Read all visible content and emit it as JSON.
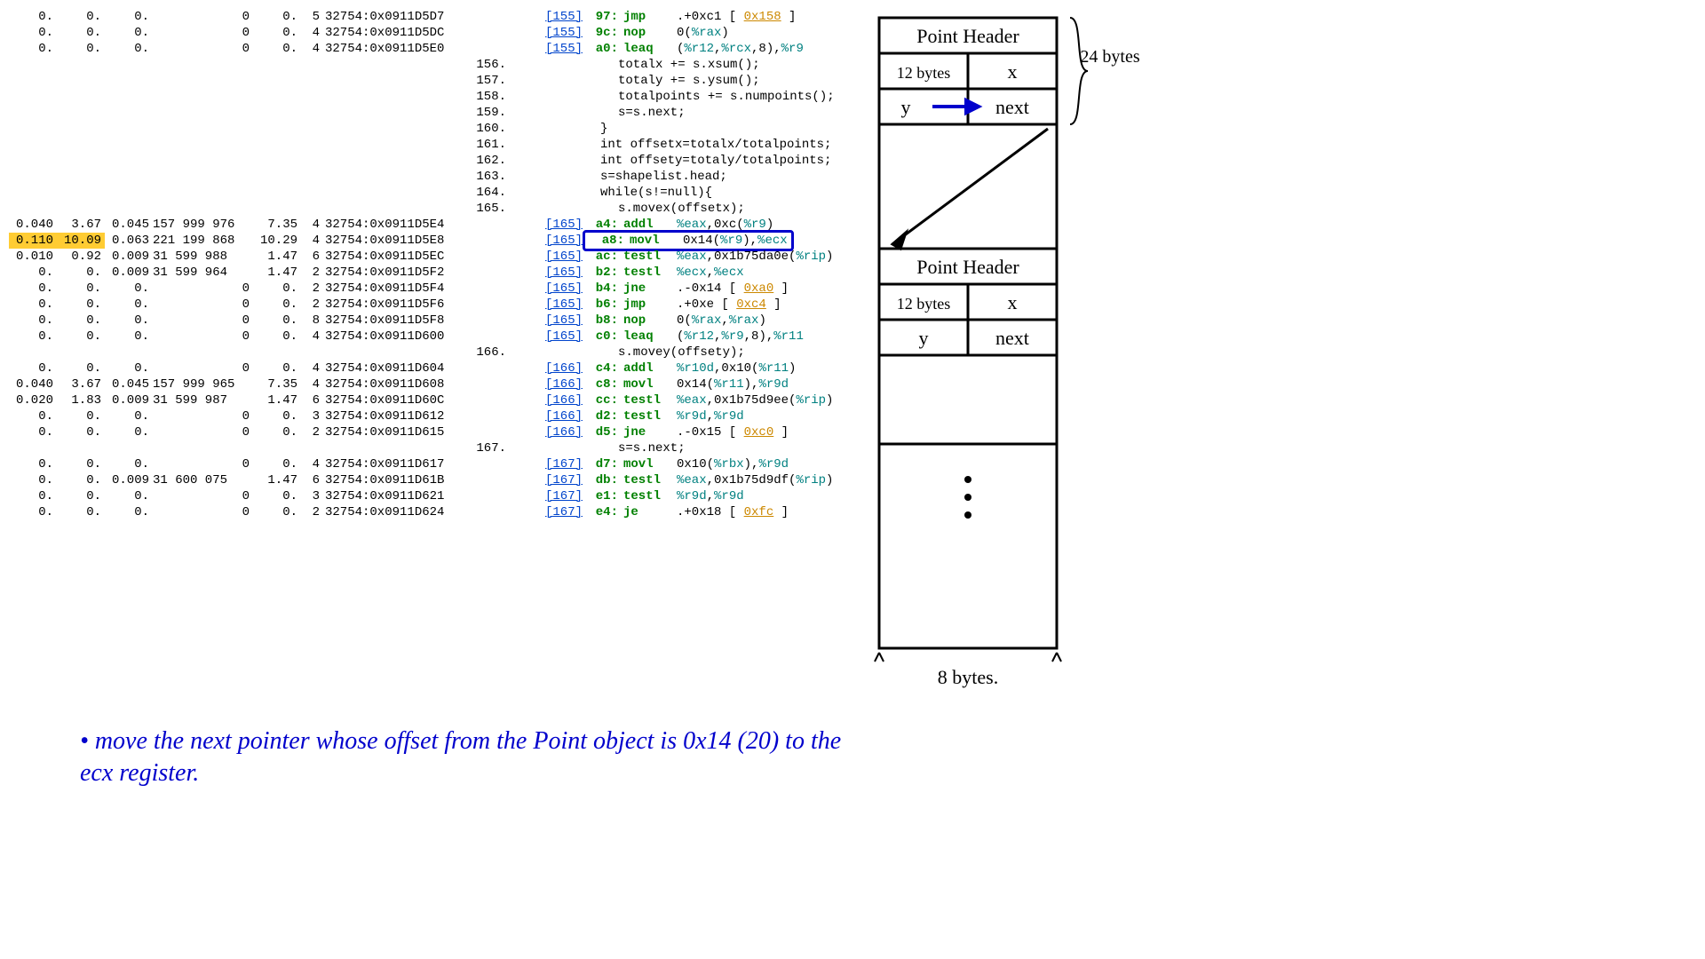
{
  "rows": [
    {
      "m": [
        "0.",
        "0.",
        "0.",
        "",
        "0",
        "0.",
        "5",
        "32754:0x0911D5D7"
      ],
      "lk": "155",
      "off": "97:",
      "mn": "jmp",
      "op": [
        {
          "t": ".+0xc1 [ "
        },
        {
          "t": "0x158",
          "c": "blk"
        },
        {
          "t": " ]"
        }
      ]
    },
    {
      "m": [
        "0.",
        "0.",
        "0.",
        "",
        "0",
        "0.",
        "4",
        "32754:0x0911D5DC"
      ],
      "lk": "155",
      "off": "9c:",
      "mn": "nop",
      "op": [
        {
          "t": "0("
        },
        {
          "t": "%rax",
          "c": "reg"
        },
        {
          "t": ")"
        }
      ]
    },
    {
      "m": [
        "0.",
        "0.",
        "0.",
        "",
        "0",
        "0.",
        "4",
        "32754:0x0911D5E0"
      ],
      "lk": "155",
      "off": "a0:",
      "mn": "leaq",
      "op": [
        {
          "t": "("
        },
        {
          "t": "%r12",
          "c": "reg"
        },
        {
          "t": ","
        },
        {
          "t": "%rcx",
          "c": "reg"
        },
        {
          "t": ",8),"
        },
        {
          "t": "%r9",
          "c": "reg"
        }
      ]
    },
    {
      "src": "156.",
      "code": "totalx += s.xsum();"
    },
    {
      "src": "157.",
      "code": "totaly += s.ysum();"
    },
    {
      "src": "158.",
      "code": "totalpoints += s.numpoints();"
    },
    {
      "src": "159.",
      "code": "s=s.next;"
    },
    {
      "src": "160.",
      "code": "}",
      "ind": -1
    },
    {
      "src": "161.",
      "code": "int offsetx=totalx/totalpoints;",
      "ind": -1
    },
    {
      "src": "162.",
      "code": "int offsety=totaly/totalpoints;",
      "ind": -1
    },
    {
      "src": "163.",
      "code": "s=shapelist.head;",
      "ind": -1
    },
    {
      "src": "164.",
      "code": "while(s!=null){",
      "ind": -1
    },
    {
      "src": "165.",
      "code": "s.movex(offsetx);"
    },
    {
      "m": [
        "0.040",
        "3.67",
        "0.045",
        "157 999 976",
        "",
        "7.35",
        "4",
        "32754:0x0911D5E4"
      ],
      "lk": "165",
      "off": "a4:",
      "mn": "addl",
      "op": [
        {
          "t": "%eax",
          "c": "reg"
        },
        {
          "t": ",0xc("
        },
        {
          "t": "%r9",
          "c": "reg"
        },
        {
          "t": ")"
        }
      ]
    },
    {
      "m": [
        "0.110",
        "10.09",
        "0.063",
        "221 199 868",
        "",
        "10.29",
        "4",
        "32754:0x0911D5E8"
      ],
      "hl": true,
      "box": true,
      "lk": "165",
      "off": "a8:",
      "mn": "movl",
      "op": [
        {
          "t": "0x14("
        },
        {
          "t": "%r9",
          "c": "reg"
        },
        {
          "t": "),"
        },
        {
          "t": "%ecx",
          "c": "reg"
        }
      ]
    },
    {
      "m": [
        "0.010",
        "0.92",
        "0.009",
        "31 599 988",
        "",
        "1.47",
        "6",
        "32754:0x0911D5EC"
      ],
      "lk": "165",
      "off": "ac:",
      "mn": "testl",
      "op": [
        {
          "t": "%eax",
          "c": "reg"
        },
        {
          "t": ",0x1b75da0e("
        },
        {
          "t": "%rip",
          "c": "reg"
        },
        {
          "t": ")"
        }
      ]
    },
    {
      "m": [
        "0.",
        "0.",
        "0.009",
        "31 599 964",
        "",
        "1.47",
        "2",
        "32754:0x0911D5F2"
      ],
      "lk": "165",
      "off": "b2:",
      "mn": "testl",
      "op": [
        {
          "t": "%ecx",
          "c": "reg"
        },
        {
          "t": ","
        },
        {
          "t": "%ecx",
          "c": "reg"
        }
      ]
    },
    {
      "m": [
        "0.",
        "0.",
        "0.",
        "",
        "0",
        "0.",
        "2",
        "32754:0x0911D5F4"
      ],
      "lk": "165",
      "off": "b4:",
      "mn": "jne",
      "op": [
        {
          "t": ".-0x14 [ "
        },
        {
          "t": "0xa0",
          "c": "blk"
        },
        {
          "t": " ]"
        }
      ]
    },
    {
      "m": [
        "0.",
        "0.",
        "0.",
        "",
        "0",
        "0.",
        "2",
        "32754:0x0911D5F6"
      ],
      "lk": "165",
      "off": "b6:",
      "mn": "jmp",
      "op": [
        {
          "t": ".+0xe [ "
        },
        {
          "t": "0xc4",
          "c": "blk"
        },
        {
          "t": " ]"
        }
      ]
    },
    {
      "m": [
        "0.",
        "0.",
        "0.",
        "",
        "0",
        "0.",
        "8",
        "32754:0x0911D5F8"
      ],
      "lk": "165",
      "off": "b8:",
      "mn": "nop",
      "op": [
        {
          "t": "0("
        },
        {
          "t": "%rax",
          "c": "reg"
        },
        {
          "t": ","
        },
        {
          "t": "%rax",
          "c": "reg"
        },
        {
          "t": ")"
        }
      ]
    },
    {
      "m": [
        "0.",
        "0.",
        "0.",
        "",
        "0",
        "0.",
        "4",
        "32754:0x0911D600"
      ],
      "lk": "165",
      "off": "c0:",
      "mn": "leaq",
      "op": [
        {
          "t": "("
        },
        {
          "t": "%r12",
          "c": "reg"
        },
        {
          "t": ","
        },
        {
          "t": "%r9",
          "c": "reg"
        },
        {
          "t": ",8),"
        },
        {
          "t": "%r11",
          "c": "reg"
        }
      ]
    },
    {
      "src": "166.",
      "code": "s.movey(offsety);"
    },
    {
      "m": [
        "0.",
        "0.",
        "0.",
        "",
        "0",
        "0.",
        "4",
        "32754:0x0911D604"
      ],
      "lk": "166",
      "off": "c4:",
      "mn": "addl",
      "op": [
        {
          "t": "%r10d",
          "c": "reg"
        },
        {
          "t": ",0x10("
        },
        {
          "t": "%r11",
          "c": "reg"
        },
        {
          "t": ")"
        }
      ]
    },
    {
      "m": [
        "0.040",
        "3.67",
        "0.045",
        "157 999 965",
        "",
        "7.35",
        "4",
        "32754:0x0911D608"
      ],
      "lk": "166",
      "off": "c8:",
      "mn": "movl",
      "op": [
        {
          "t": "0x14("
        },
        {
          "t": "%r11",
          "c": "reg"
        },
        {
          "t": "),"
        },
        {
          "t": "%r9d",
          "c": "reg"
        }
      ]
    },
    {
      "m": [
        "0.020",
        "1.83",
        "0.009",
        "31 599 987",
        "",
        "1.47",
        "6",
        "32754:0x0911D60C"
      ],
      "lk": "166",
      "off": "cc:",
      "mn": "testl",
      "op": [
        {
          "t": "%eax",
          "c": "reg"
        },
        {
          "t": ",0x1b75d9ee("
        },
        {
          "t": "%rip",
          "c": "reg"
        },
        {
          "t": ")"
        }
      ]
    },
    {
      "m": [
        "0.",
        "0.",
        "0.",
        "",
        "0",
        "0.",
        "3",
        "32754:0x0911D612"
      ],
      "lk": "166",
      "off": "d2:",
      "mn": "testl",
      "op": [
        {
          "t": "%r9d",
          "c": "reg"
        },
        {
          "t": ","
        },
        {
          "t": "%r9d",
          "c": "reg"
        }
      ]
    },
    {
      "m": [
        "0.",
        "0.",
        "0.",
        "",
        "0",
        "0.",
        "2",
        "32754:0x0911D615"
      ],
      "lk": "166",
      "off": "d5:",
      "mn": "jne",
      "op": [
        {
          "t": ".-0x15 [ "
        },
        {
          "t": "0xc0",
          "c": "blk"
        },
        {
          "t": " ]"
        }
      ]
    },
    {
      "src": "167.",
      "code": "s=s.next;"
    },
    {
      "m": [
        "0.",
        "0.",
        "0.",
        "",
        "0",
        "0.",
        "4",
        "32754:0x0911D617"
      ],
      "lk": "167",
      "off": "d7:",
      "mn": "movl",
      "op": [
        {
          "t": "0x10("
        },
        {
          "t": "%rbx",
          "c": "reg"
        },
        {
          "t": "),"
        },
        {
          "t": "%r9d",
          "c": "reg"
        }
      ]
    },
    {
      "m": [
        "0.",
        "0.",
        "0.009",
        "31 600 075",
        "",
        "1.47",
        "6",
        "32754:0x0911D61B"
      ],
      "lk": "167",
      "off": "db:",
      "mn": "testl",
      "op": [
        {
          "t": "%eax",
          "c": "reg"
        },
        {
          "t": ",0x1b75d9df("
        },
        {
          "t": "%rip",
          "c": "reg"
        },
        {
          "t": ")"
        }
      ]
    },
    {
      "m": [
        "0.",
        "0.",
        "0.",
        "",
        "0",
        "0.",
        "3",
        "32754:0x0911D621"
      ],
      "lk": "167",
      "off": "e1:",
      "mn": "testl",
      "op": [
        {
          "t": "%r9d",
          "c": "reg"
        },
        {
          "t": ","
        },
        {
          "t": "%r9d",
          "c": "reg"
        }
      ]
    },
    {
      "m": [
        "0.",
        "0.",
        "0.",
        "",
        "0",
        "0.",
        "2",
        "32754:0x0911D624"
      ],
      "lk": "167",
      "off": "e4:",
      "mn": "je",
      "op": [
        {
          "t": ".+0x18 [ "
        },
        {
          "t": "0xfc",
          "c": "blk"
        },
        {
          "t": " ]"
        }
      ]
    }
  ],
  "note": "move the next pointer whose offset from the Point object is 0x14 (20) to the ecx register.",
  "diagram": {
    "labels": {
      "header": "Point Header",
      "sz12": "12 bytes",
      "x": "x",
      "y": "y",
      "next": "next",
      "w": "8 bytes.",
      "h": "24 bytes"
    }
  }
}
